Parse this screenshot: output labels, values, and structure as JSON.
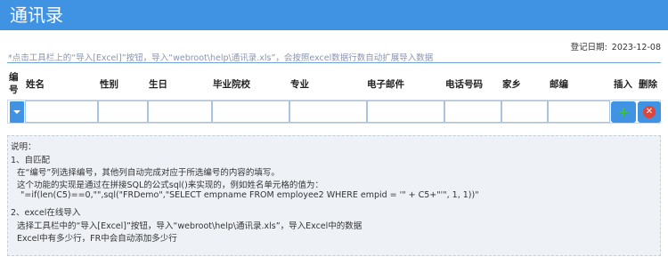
{
  "header": {
    "title": "通讯录"
  },
  "date": {
    "label": "登记日期:",
    "value": "2023-12-08"
  },
  "hint": "*点击工具栏上的“导入[Excel]”按钮，导入“webroot\\help\\通讯录.xls”，会按照excel数据行数自动扩展导入数据",
  "columns": {
    "id_line1": "编",
    "id_line2": "号",
    "name": "姓名",
    "gender": "性别",
    "birthday": "生日",
    "school": "毕业院校",
    "major": "专业",
    "email": "电子邮件",
    "phone": "电话号码",
    "hometown": "家乡",
    "zip": "邮编",
    "insert": "插入",
    "delete": "删除"
  },
  "buttons": {
    "delete_symbol": "✕"
  },
  "notes": [
    "说明：",
    "1、自匹配",
    "在“编号”列选择编号，其他列自动完成对应于所选编号的内容的填写。",
    "这个功能的实现是通过在拼接SQL的公式sql()来实现的，例如姓名单元格的值为：",
    "\"=if(len(C5)==0,\"\",sql(\"FRDemo\",\"SELECT empname FROM employee2 WHERE empid = '\" + C5+\"'\", 1, 1))\"",
    "2、excel在线导入",
    "选择工具栏中的“导入[Excel]”按钮，导入“webroot\\help\\通讯录.xls”，导入Excel中的数据",
    "Excel中有多少行，FR中会自动添加多少行"
  ],
  "colors": {
    "header_bg": "#3f93e2",
    "add_plus": "#3fbf3f",
    "delete_red": "#e0443a"
  }
}
